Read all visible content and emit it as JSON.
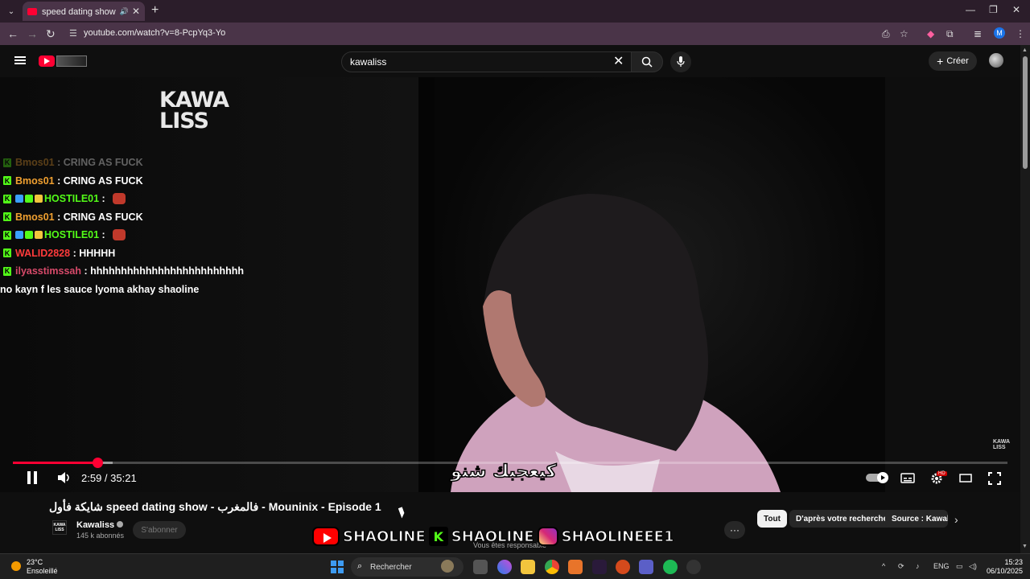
{
  "browser": {
    "tab_title": "speed dating show شايكة فأول",
    "url": "youtube.com/watch?v=8-PcpYq3-Yo",
    "profile_initial": "M"
  },
  "header": {
    "search_value": "kawaliss",
    "create_label": "Créer"
  },
  "video": {
    "watermark_line1": "KAWA",
    "watermark_line2": "LISS",
    "subtitle": "كيعجبك شنو",
    "current_time": "2:59",
    "duration": "35:21",
    "time_display": "2:59 / 35:21",
    "progress_fraction": 0.085,
    "hd_badge": "HD",
    "corner_logo": "KAWA LISS",
    "chat": [
      {
        "user": "Bmos01",
        "msg": "CRING AS FUCK",
        "user_color": "#f0a030",
        "faded": true,
        "badges": [
          "k"
        ]
      },
      {
        "user": "Bmos01",
        "msg": "CRING AS FUCK",
        "user_color": "#f0a030",
        "faded": false,
        "badges": [
          "k"
        ]
      },
      {
        "user": "HOSTILE01",
        "msg": "",
        "user_color": "#53fc18",
        "faded": false,
        "badges": [
          "k",
          "cube",
          "star",
          "gold"
        ],
        "emote": true
      },
      {
        "user": "Bmos01",
        "msg": "CRING AS FUCK",
        "user_color": "#f0a030",
        "faded": false,
        "badges": [
          "k"
        ]
      },
      {
        "user": "HOSTILE01",
        "msg": "",
        "user_color": "#53fc18",
        "faded": false,
        "badges": [
          "k",
          "cube",
          "star",
          "gold"
        ],
        "emote": true
      },
      {
        "user": "WALID2828",
        "msg": "HHHHH",
        "user_color": "#ff3b3b",
        "faded": false,
        "badges": [
          "k"
        ]
      },
      {
        "user": "ilyasstimssah",
        "msg": "hhhhhhhhhhhhhhhhhhhhhhhhh",
        "user_color": "#d84a6a",
        "faded": false,
        "badges": [
          "k"
        ]
      },
      {
        "user": "",
        "msg": "no kayn f les sauce lyoma akhay shaoline",
        "user_color": "#ffffff",
        "faded": false,
        "badges": []
      }
    ]
  },
  "below": {
    "title": "شايكة فأول speed dating show - فالمغرب - Mouninix - Episode 1",
    "channel_name": "Kawaliss",
    "channel_avatar_text": "KAWA LISS",
    "subscribers": "145 k abonnés",
    "subscribe_label": "S'abonner",
    "more_label": "···",
    "chips": [
      "Tout",
      "D'après votre recherche",
      "Source : Kawaliss"
    ],
    "responsible_text": "Vous êtes responsable"
  },
  "banner": {
    "youtube_name": "SHAOLINE",
    "kick_name": "SHAOLINE",
    "instagram_name": "SHAOLINEEE1",
    "kick_letter": "K"
  },
  "taskbar": {
    "temperature": "23°C",
    "weather": "Ensoleillé",
    "search_placeholder": "Rechercher",
    "language": "ENG",
    "time": "15:23",
    "date": "06/10/2025"
  },
  "colors": {
    "accent": "#ff0033",
    "kick_green": "#53fc18",
    "browser_frame": "#4a3448"
  }
}
